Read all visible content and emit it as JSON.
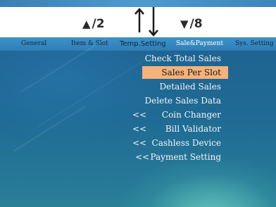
{
  "navigation": {
    "up_label": "/2",
    "down_label": "/8",
    "up_icon": "up-triangle-icon",
    "down_icon": "down-triangle-icon"
  },
  "tabs": [
    {
      "label": "General"
    },
    {
      "label": "Item & Slot"
    },
    {
      "label": "Temp.Setting"
    },
    {
      "label": "Sale&Payment",
      "active": true
    },
    {
      "label": "Sys. Setting"
    }
  ],
  "menu": {
    "items": [
      {
        "label": "Check Total Sales",
        "prefix": ""
      },
      {
        "label": "Sales Per Slot",
        "prefix": "",
        "selected": true
      },
      {
        "label": "Detailed Sales",
        "prefix": ""
      },
      {
        "label": "Delete Sales Data",
        "prefix": ""
      },
      {
        "label": "Coin Changer",
        "prefix": "<<"
      },
      {
        "label": "Bill Validator",
        "prefix": "<<"
      },
      {
        "label": "Cashless Device",
        "prefix": "<<"
      },
      {
        "label": "Payment Setting",
        "prefix": "<<"
      }
    ]
  },
  "colors": {
    "selection": "#f5b27a",
    "tab_bar": "#3a8bc2",
    "background": "#1f6492"
  }
}
